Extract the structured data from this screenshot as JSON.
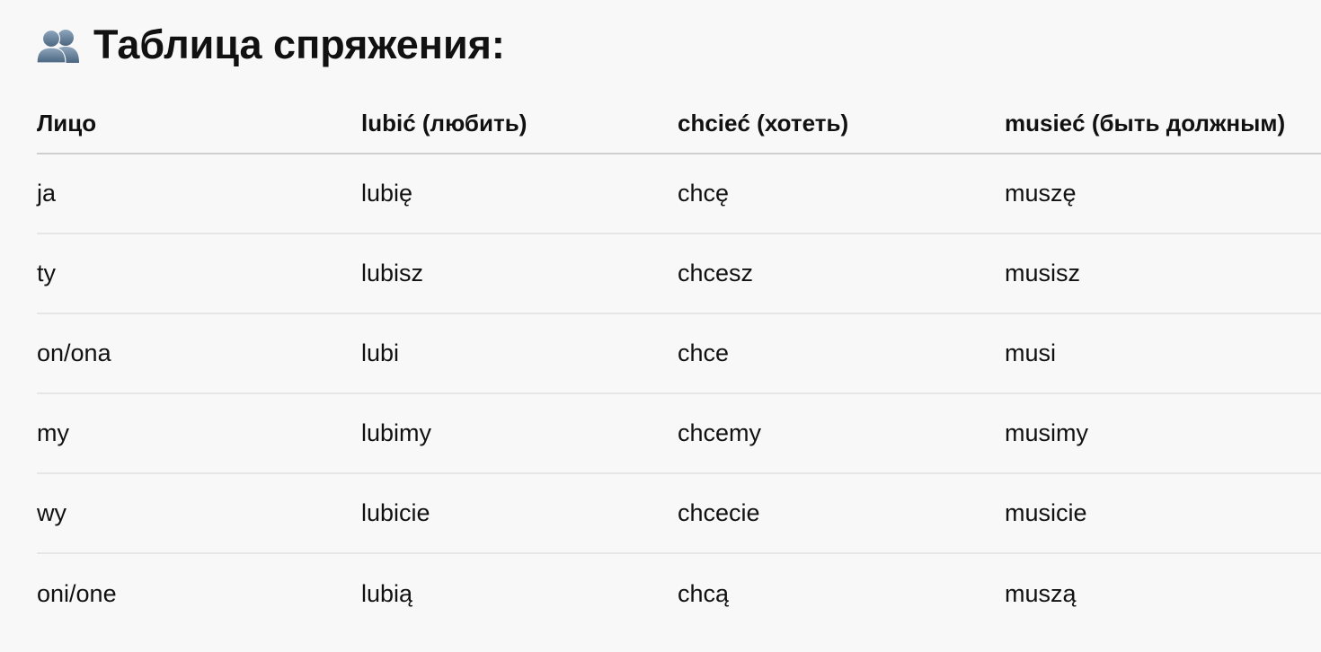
{
  "heading": {
    "icon": "two-people-silhouette-icon",
    "text": "Таблица спряжения:"
  },
  "table": {
    "columns": [
      "Лицо",
      "lubić (любить)",
      "chcieć (хотеть)",
      "musieć (быть должным)"
    ],
    "rows": [
      [
        "ja",
        "lubię",
        "chcę",
        "muszę"
      ],
      [
        "ty",
        "lubisz",
        "chcesz",
        "musisz"
      ],
      [
        "on/ona",
        "lubi",
        "chce",
        "musi"
      ],
      [
        "my",
        "lubimy",
        "chcemy",
        "musimy"
      ],
      [
        "wy",
        "lubicie",
        "chcecie",
        "musicie"
      ],
      [
        "oni/one",
        "lubią",
        "chcą",
        "muszą"
      ]
    ]
  },
  "colors": {
    "background": "#f8f8f8",
    "text": "#111111",
    "icon": "#5b7894",
    "row_divider": "#e6e6e6",
    "header_divider": "#cfcfcf"
  }
}
